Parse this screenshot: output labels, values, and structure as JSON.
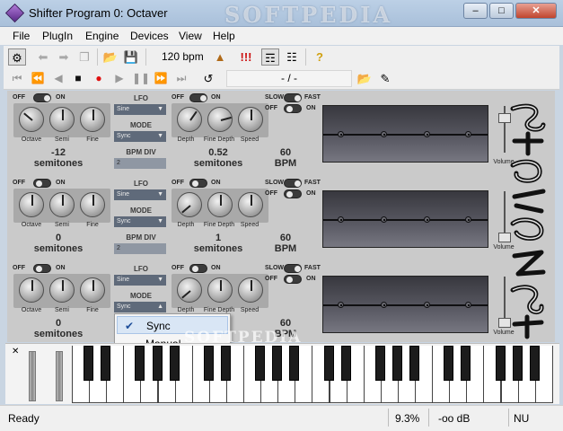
{
  "window": {
    "title": "Shifter Program 0: Octaver",
    "watermark": "SOFTPEDIA"
  },
  "menu": [
    "File",
    "PlugIn",
    "Engine",
    "Devices",
    "View",
    "Help"
  ],
  "toolbar": {
    "tempo": "120 bpm",
    "position": "- / -"
  },
  "rows": [
    {
      "toggle_off": "OFF",
      "toggle_on": "ON",
      "knobs": [
        "Octave",
        "Semi",
        "Fine"
      ],
      "value": "-12",
      "value_unit": "semitones",
      "lfo": {
        "label": "LFO",
        "wave": "Sine",
        "mode_label": "MODE",
        "mode": "Sync",
        "bpmdiv_label": "BPM DIV",
        "bpmdiv": "2"
      },
      "depth_knobs": [
        "Depth",
        "Fine Depth",
        "Speed"
      ],
      "depth_value": "0.52",
      "depth_unit": "semitones",
      "speed": {
        "slow": "SLOW",
        "fast": "FAST",
        "value": "60",
        "unit": "BPM"
      },
      "volume_label": "Volume"
    },
    {
      "toggle_off": "OFF",
      "toggle_on": "ON",
      "knobs": [
        "Octave",
        "Semi",
        "Fine"
      ],
      "value": "0",
      "value_unit": "semitones",
      "lfo": {
        "label": "LFO",
        "wave": "Sine",
        "mode_label": "MODE",
        "mode": "Sync",
        "bpmdiv_label": "BPM DIV",
        "bpmdiv": "2"
      },
      "depth_knobs": [
        "Depth",
        "Fine Depth",
        "Speed"
      ],
      "depth_value": "1",
      "depth_unit": "semitones",
      "speed": {
        "slow": "SLOW",
        "fast": "FAST",
        "value": "60",
        "unit": "BPM"
      },
      "volume_label": "Volume"
    },
    {
      "toggle_off": "OFF",
      "toggle_on": "ON",
      "knobs": [
        "Octave",
        "Semi",
        "Fine"
      ],
      "value": "0",
      "value_unit": "semitones",
      "lfo": {
        "label": "LFO",
        "wave": "Sine",
        "mode_label": "MODE",
        "mode": "Sync",
        "bpmdiv_label": "",
        "bpmdiv": ""
      },
      "depth_knobs": [
        "Depth",
        "Fine Depth",
        "Speed"
      ],
      "depth_value": "",
      "depth_unit": "",
      "speed": {
        "slow": "SLOW",
        "fast": "FAST",
        "value": "60",
        "unit": "BPM"
      },
      "volume_label": "Volume"
    }
  ],
  "popup": {
    "items": [
      "Sync",
      "Manual"
    ],
    "checked": "Sync"
  },
  "status": {
    "text": "Ready",
    "cpu": "9.3%",
    "level": "-oo dB",
    "mode": "NU"
  }
}
